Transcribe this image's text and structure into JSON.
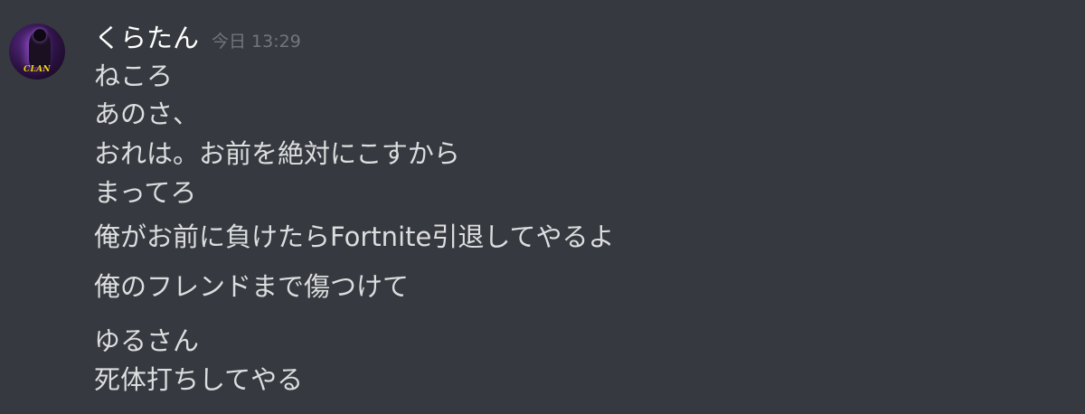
{
  "message": {
    "username": "くらたん",
    "timestamp": "今日 13:29",
    "avatar": {
      "badge_text": "CLAN"
    },
    "lines": [
      "ねころ",
      "あのさ、",
      "おれは。お前を絶対にこすから",
      "まってろ",
      "俺がお前に負けたらFortnite引退してやるよ",
      "俺のフレンドまで傷つけて",
      "ゆるさん",
      "死体打ちしてやる"
    ]
  },
  "colors": {
    "background": "#36393f",
    "username": "#ffffff",
    "message_text": "#dcddde",
    "timestamp": "#72767d",
    "avatar_badge": "#f3d21a"
  }
}
